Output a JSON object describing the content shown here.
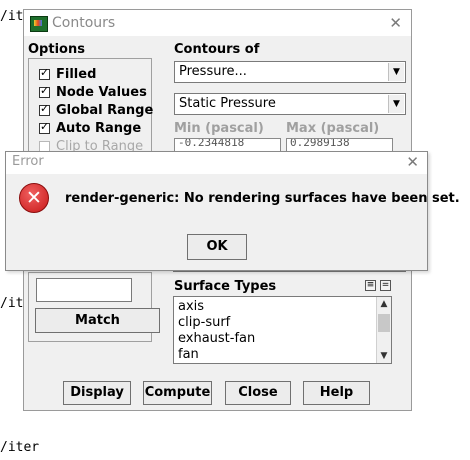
{
  "console": {
    "line1": "/it",
    "line2": "/it",
    "line3": "/iter"
  },
  "contours_window": {
    "title": "Contours",
    "close_label": "✕",
    "options": {
      "title": "Options",
      "items": [
        {
          "label": "Filled",
          "checked": true
        },
        {
          "label": "Node Values",
          "checked": true
        },
        {
          "label": "Global Range",
          "checked": true
        },
        {
          "label": "Auto Range",
          "checked": true
        },
        {
          "label": "Clip to Range",
          "checked": false
        }
      ]
    },
    "contours_of": {
      "title": "Contours of",
      "category_value": "Pressure...",
      "quantity_value": "Static Pressure"
    },
    "range": {
      "min_label": "Min (pascal)",
      "max_label": "Max (pascal)",
      "min_value": "-0.2344818",
      "max_value": "0.2989138"
    },
    "match": {
      "button_label": "Match"
    },
    "surface_types": {
      "title": "Surface Types",
      "items": [
        "axis",
        "clip-surf",
        "exhaust-fan",
        "fan"
      ]
    },
    "buttons": {
      "display": "Display",
      "compute": "Compute",
      "close": "Close",
      "help": "Help"
    }
  },
  "error_dialog": {
    "title": "Error",
    "close_label": "✕",
    "icon": "error-x-icon",
    "message": "render-generic: No rendering surfaces have been set.",
    "ok_label": "OK"
  },
  "colors": {
    "error_icon": "#d42020",
    "window_bg": "#f0f0f0"
  }
}
